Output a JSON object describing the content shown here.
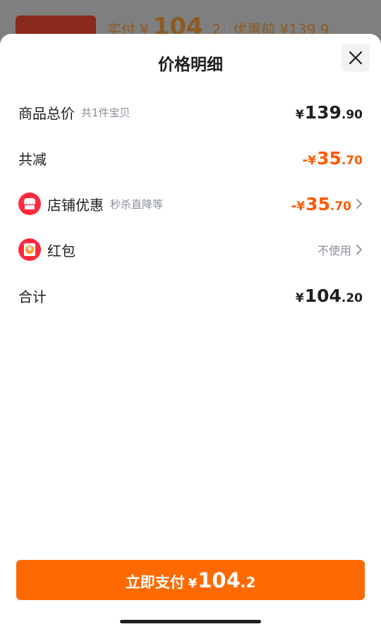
{
  "background": {
    "paid_label": "实付",
    "paid_currency": "¥",
    "paid_int": "104",
    "paid_dec": ".2",
    "separator": "|",
    "before_discount": "优惠前 ¥139.9"
  },
  "sheet": {
    "title": "价格明细"
  },
  "rows": {
    "subtotal": {
      "label": "商品总价",
      "sub": "共1件宝贝",
      "currency": "¥",
      "int": "139",
      "dec": ".90"
    },
    "total_discount": {
      "label": "共减",
      "minus": "-",
      "currency": "¥",
      "int": "35",
      "dec": ".70"
    },
    "shop_discount": {
      "label": "店铺优惠",
      "sub": "秒杀直降等",
      "minus": "-",
      "currency": "¥",
      "int": "35",
      "dec": ".70",
      "icon": "store-icon"
    },
    "red_packet": {
      "label": "红包",
      "value": "不使用",
      "icon": "red-packet-icon",
      "icon_glyph": "¥"
    },
    "total": {
      "label": "合计",
      "currency": "¥",
      "int": "104",
      "dec": ".20"
    }
  },
  "pay_button": {
    "label": "立即支付",
    "currency": "¥",
    "int": "104",
    "dec": ".2"
  },
  "colors": {
    "accent": "#ff6a00",
    "discount": "#ff5a00",
    "icon_red": "#ff2a3d"
  }
}
